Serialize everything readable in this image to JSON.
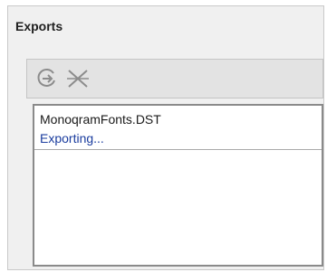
{
  "panel": {
    "title": "Exports"
  },
  "toolbar": {
    "refresh_icon": "refresh-icon",
    "cancel_icon": "cancel-icon"
  },
  "exports": {
    "items": [
      {
        "name": "MonoqramFonts.DST",
        "status": "Exporting..."
      }
    ]
  },
  "colors": {
    "status_text": "#1a3c9e",
    "panel_bg": "#f0f0f0",
    "toolbar_bg": "#e3e3e3"
  }
}
